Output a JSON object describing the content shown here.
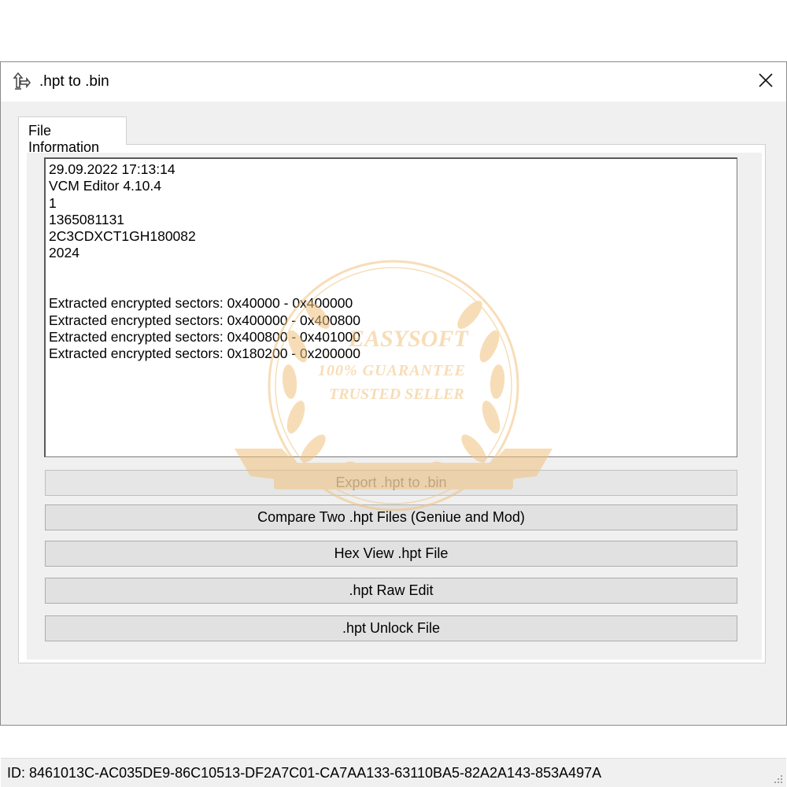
{
  "window": {
    "title": ".hpt to .bin",
    "icon": "convert-arrows-icon",
    "close_icon": "close-icon"
  },
  "tabs": [
    {
      "label": "File Information",
      "active": true
    }
  ],
  "info_box": {
    "lines": [
      "29.09.2022 17:13:14",
      "VCM Editor 4.10.4",
      "1",
      "1365081131",
      "2C3CDXCT1GH180082",
      "2024",
      "",
      "",
      "Extracted encrypted sectors: 0x40000 - 0x400000",
      "Extracted encrypted sectors: 0x400000 - 0x400800",
      "Extracted encrypted sectors: 0x400800 - 0x401000",
      "Extracted encrypted sectors: 0x180200 - 0x200000"
    ]
  },
  "buttons": {
    "export": {
      "label": "Export .hpt to .bin",
      "enabled": false
    },
    "compare": {
      "label": "Compare Two .hpt Files (Geniue and Mod)",
      "enabled": true
    },
    "hex_view": {
      "label": "Hex View .hpt File",
      "enabled": true
    },
    "raw_edit": {
      "label": ".hpt Raw Edit",
      "enabled": true
    },
    "unlock": {
      "label": ".hpt Unlock File",
      "enabled": true
    }
  },
  "status_bar": {
    "id_text": "ID:  8461013C-AC035DE9-86C10513-DF2A7C01-CA7AA133-63110BA5-82A2A143-853A497A"
  },
  "watermark": {
    "brand": "EASYSOFT",
    "line1": "100% GUARANTEE",
    "line2": "TRUSTED SELLER",
    "color": "#f1c27d"
  }
}
